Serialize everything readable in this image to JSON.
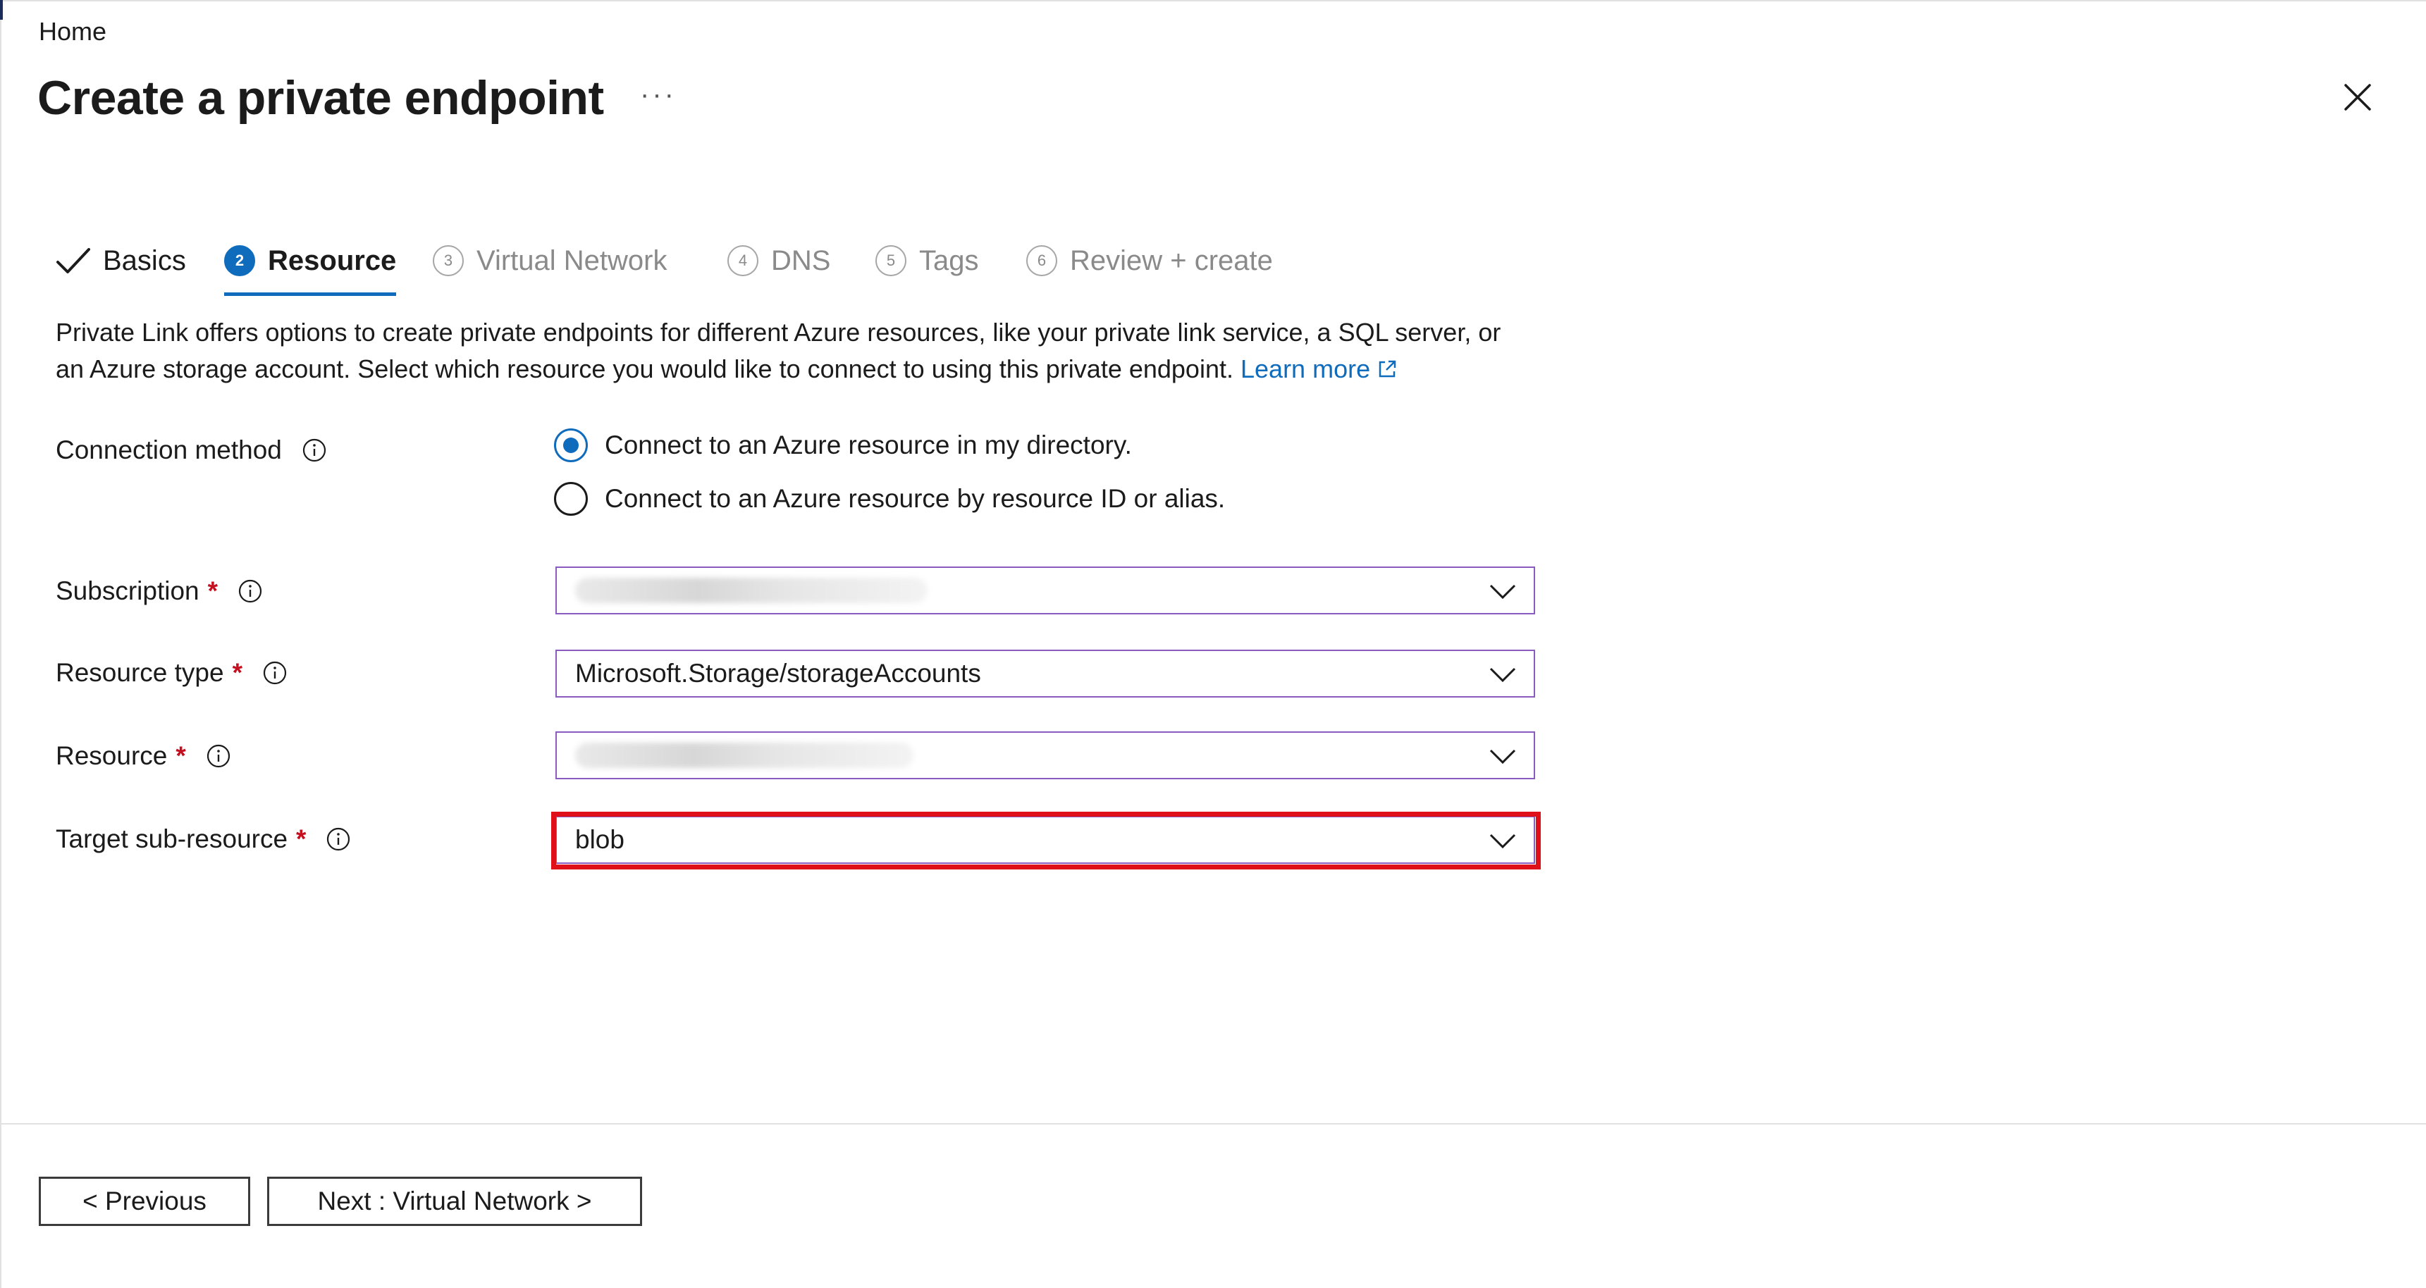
{
  "header": {
    "breadcrumb": "Home",
    "title": "Create a private endpoint",
    "more_label": "···"
  },
  "tabs": [
    {
      "label": "Basics",
      "number": "",
      "state": "done"
    },
    {
      "label": "Resource",
      "number": "2",
      "state": "active"
    },
    {
      "label": "Virtual Network",
      "number": "3",
      "state": "inactive"
    },
    {
      "label": "DNS",
      "number": "4",
      "state": "inactive"
    },
    {
      "label": "Tags",
      "number": "5",
      "state": "inactive"
    },
    {
      "label": "Review + create",
      "number": "6",
      "state": "inactive"
    }
  ],
  "description": {
    "line1": "Private Link offers options to create private endpoints for different Azure resources, like your private link service, a SQL server, or",
    "line2": "an Azure storage account. Select which resource you would like to connect to using this private endpoint.",
    "learn_more": "Learn more"
  },
  "form": {
    "connection_method": {
      "label": "Connection method",
      "options": [
        {
          "label": "Connect to an Azure resource in my directory.",
          "selected": true
        },
        {
          "label": "Connect to an Azure resource by resource ID or alias.",
          "selected": false
        }
      ]
    },
    "subscription": {
      "label": "Subscription",
      "required": "*",
      "value": ""
    },
    "resource_type": {
      "label": "Resource type",
      "required": "*",
      "value": "Microsoft.Storage/storageAccounts"
    },
    "resource": {
      "label": "Resource",
      "required": "*",
      "value": ""
    },
    "target_sub_resource": {
      "label": "Target sub-resource",
      "required": "*",
      "value": "blob"
    }
  },
  "footer": {
    "previous_label": "< Previous",
    "next_label": "Next : Virtual Network >"
  },
  "colors": {
    "accent": "#0f6cbd",
    "select_border": "#8a5cc0",
    "highlight": "#e0101b",
    "required": "#c50f1f"
  },
  "icons": {
    "close": "close-icon",
    "info": "info-icon",
    "chevron": "chevron-down-icon",
    "external": "external-link-icon",
    "check": "check-icon"
  }
}
